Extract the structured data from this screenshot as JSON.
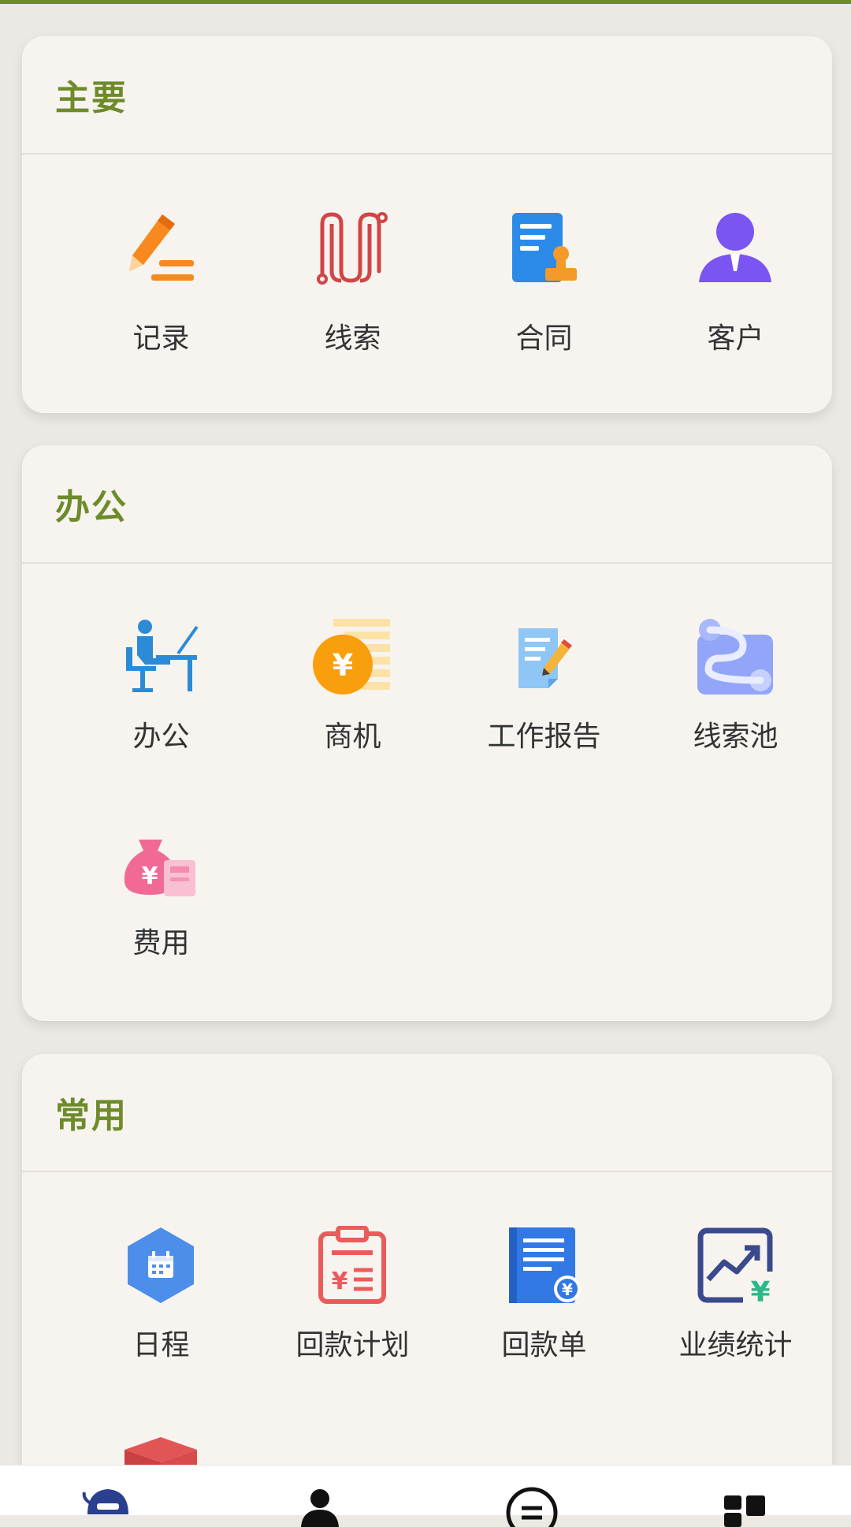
{
  "sections": [
    {
      "title": "主要",
      "items": [
        {
          "label": "记录",
          "icon": "pencil-record-icon"
        },
        {
          "label": "线索",
          "icon": "clue-path-icon"
        },
        {
          "label": "合同",
          "icon": "contract-seal-icon"
        },
        {
          "label": "客户",
          "icon": "customer-person-icon"
        }
      ]
    },
    {
      "title": "办公",
      "items": [
        {
          "label": "办公",
          "icon": "office-desk-icon"
        },
        {
          "label": "商机",
          "icon": "opportunity-coin-icon"
        },
        {
          "label": "工作报告",
          "icon": "work-report-icon"
        },
        {
          "label": "线索池",
          "icon": "clue-pool-icon"
        },
        {
          "label": "费用",
          "icon": "expense-moneybag-icon"
        }
      ]
    },
    {
      "title": "常用",
      "items": [
        {
          "label": "日程",
          "icon": "schedule-calendar-icon"
        },
        {
          "label": "回款计划",
          "icon": "payment-plan-icon"
        },
        {
          "label": "回款单",
          "icon": "payment-receipt-icon"
        },
        {
          "label": "业绩统计",
          "icon": "performance-stats-icon"
        }
      ]
    }
  ],
  "colors": {
    "accent": "#6E8B2A",
    "card_bg": "#F7F4F0",
    "page_bg": "#ECE9E4"
  },
  "bottom_nav": [
    {
      "icon": "home-icon"
    },
    {
      "icon": "contacts-person-icon"
    },
    {
      "icon": "messages-icon"
    },
    {
      "icon": "apps-grid-icon"
    }
  ]
}
